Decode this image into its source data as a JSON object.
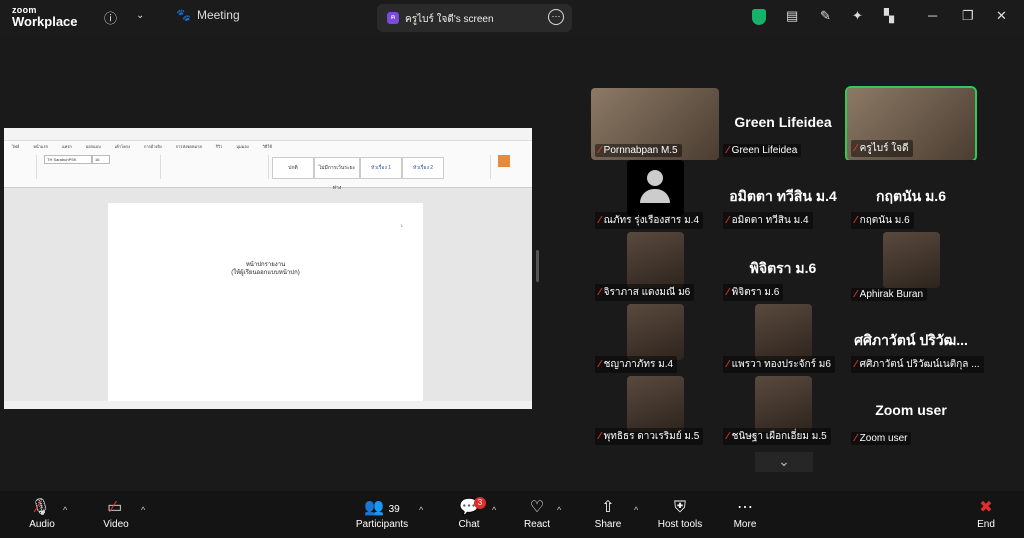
{
  "app": {
    "logo_line1": "zoom",
    "logo_line2": "Workplace"
  },
  "topbar": {
    "meeting_label": "Meeting",
    "share_tab_label": "ครูไบร์ ใจดี's screen",
    "share_badge": "ค"
  },
  "shared_document": {
    "menu_tabs": [
      "ไฟล์",
      "หน้าแรก",
      "แทรก",
      "ออกแบบ",
      "เค้าโครง",
      "การอ้างอิง",
      "การส่งจดหมาย",
      "รีวิว",
      "มุมมอง",
      "วิธีใช้"
    ],
    "font_name": "TH SarabunPSK",
    "font_size": "16",
    "styles": [
      "ปกติ",
      "ไม่มีการเว้นระยะห่าง",
      "หัวเรื่อง 1",
      "หัวเรื่อง 2"
    ],
    "page_line1": "หน้าปกรายงาน",
    "page_line2": "(ให้ผู้เรียนออกแบบหน้าปก)",
    "page_number": "1"
  },
  "participants": [
    {
      "tile_name": "Pornnabpan M.5",
      "big": ""
    },
    {
      "tile_name": "Green Lifeidea",
      "big": "Green Lifeidea"
    },
    {
      "tile_name": "ครูไบร์ ใจดี",
      "big": ""
    },
    {
      "tile_name": "ณภัทร รุ่งเรืองสาร ม.4",
      "big": ""
    },
    {
      "tile_name": "อมิตตา ทวีสิน ม.4",
      "big": "อมิตตา ทวีสิน ม.4"
    },
    {
      "tile_name": "กฤตนัน ม.6",
      "big": "กฤตนัน ม.6"
    },
    {
      "tile_name": "จิราภาส แดงมณี ม6",
      "big": ""
    },
    {
      "tile_name": "พิจิตรา ม.6",
      "big": "พิจิตรา ม.6"
    },
    {
      "tile_name": "Aphirak Buran",
      "big": ""
    },
    {
      "tile_name": "ชญาภาภัทร ม.4",
      "big": ""
    },
    {
      "tile_name": "แพรวา ทองประจักร์ ม6",
      "big": ""
    },
    {
      "tile_name": "ศศิภาวัตน์ ปริวัฒน์เนติกุล ...",
      "big": "ศศิภาวัตน์ ปริวัฒ..."
    },
    {
      "tile_name": "พุทธิธร ดาวเรริมย์ ม.5",
      "big": ""
    },
    {
      "tile_name": "ชนิษฐา เผือกเอี่ยม ม.5",
      "big": ""
    },
    {
      "tile_name": "Zoom user",
      "big": "Zoom user"
    }
  ],
  "toolbar": {
    "audio": "Audio",
    "video": "Video",
    "participants": "Participants",
    "participants_count": "39",
    "chat": "Chat",
    "chat_badge": "3",
    "react": "React",
    "share": "Share",
    "host_tools": "Host tools",
    "more": "More",
    "end": "End"
  },
  "colors": {
    "accent_green": "#35c759",
    "end_red": "#e02e2e",
    "share_badge": "#7a4ad9"
  }
}
